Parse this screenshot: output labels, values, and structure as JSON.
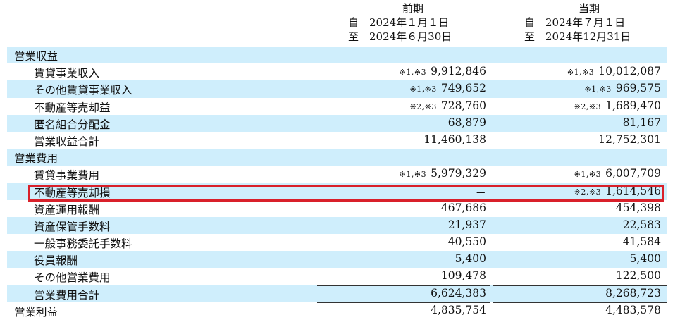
{
  "header": {
    "prev": {
      "title": "前期",
      "from_label": "自",
      "from_date": "2024年１月１日",
      "to_label": "至",
      "to_date": "2024年６月30日"
    },
    "curr": {
      "title": "当期",
      "from_label": "自",
      "from_date": "2024年７月１日",
      "to_label": "至",
      "to_date": "2024年12月31日"
    }
  },
  "rows": [
    {
      "label": "営業収益",
      "indent": 0,
      "shaded": true,
      "note1": "",
      "v1": "",
      "note2": "",
      "v2": ""
    },
    {
      "label": "賃貸事業収入",
      "indent": 1,
      "shaded": false,
      "note1": "※1,※3",
      "v1": "9,912,846",
      "note2": "※1,※3",
      "v2": "10,012,087"
    },
    {
      "label": "その他賃貸事業収入",
      "indent": 1,
      "shaded": true,
      "note1": "※1,※3",
      "v1": "749,652",
      "note2": "※1,※3",
      "v2": "969,575"
    },
    {
      "label": "不動産等売却益",
      "indent": 1,
      "shaded": false,
      "note1": "※2,※3",
      "v1": "728,760",
      "note2": "※2,※3",
      "v2": "1,689,470"
    },
    {
      "label": "匿名組合分配金",
      "indent": 1,
      "shaded": true,
      "note1": "",
      "v1": "68,879",
      "note2": "",
      "v2": "81,167"
    },
    {
      "label": "営業収益合計",
      "indent": 1,
      "shaded": false,
      "note1": "",
      "v1": "11,460,138",
      "note2": "",
      "v2": "12,752,301",
      "underline": true
    },
    {
      "label": "営業費用",
      "indent": 0,
      "shaded": true,
      "note1": "",
      "v1": "",
      "note2": "",
      "v2": ""
    },
    {
      "label": "賃貸事業費用",
      "indent": 1,
      "shaded": false,
      "note1": "※1,※3",
      "v1": "5,979,329",
      "note2": "※1,※3",
      "v2": "6,007,709"
    },
    {
      "label": "不動産等売却損",
      "indent": 1,
      "shaded": true,
      "note1": "",
      "v1": "－",
      "note2": "※2,※3",
      "v2": "1,614,546"
    },
    {
      "label": "資産運用報酬",
      "indent": 1,
      "shaded": false,
      "note1": "",
      "v1": "467,686",
      "note2": "",
      "v2": "454,398"
    },
    {
      "label": "資産保管手数料",
      "indent": 1,
      "shaded": true,
      "note1": "",
      "v1": "21,937",
      "note2": "",
      "v2": "22,583"
    },
    {
      "label": "一般事務委託手数料",
      "indent": 1,
      "shaded": false,
      "note1": "",
      "v1": "40,550",
      "note2": "",
      "v2": "41,584"
    },
    {
      "label": "役員報酬",
      "indent": 1,
      "shaded": true,
      "note1": "",
      "v1": "5,400",
      "note2": "",
      "v2": "5,400"
    },
    {
      "label": "その他営業費用",
      "indent": 1,
      "shaded": false,
      "note1": "",
      "v1": "109,478",
      "note2": "",
      "v2": "122,500"
    },
    {
      "label": "営業費用合計",
      "indent": 1,
      "shaded": true,
      "note1": "",
      "v1": "6,624,383",
      "note2": "",
      "v2": "8,268,723",
      "underline": true
    },
    {
      "label": "営業利益",
      "indent": 0,
      "shaded": false,
      "note1": "",
      "v1": "4,835,754",
      "note2": "",
      "v2": "4,483,578",
      "underline": true
    }
  ],
  "highlight_color": "#d9202a",
  "shade_color": "#cfeefc"
}
